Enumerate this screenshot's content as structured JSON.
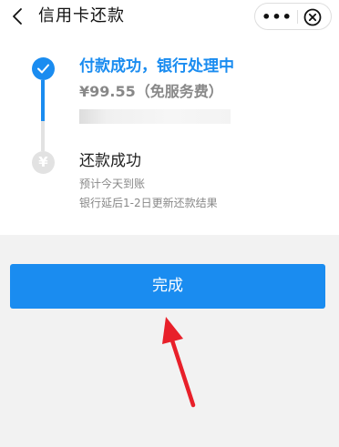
{
  "header": {
    "title": "信用卡还款",
    "back_icon": "chevron-left-icon",
    "more_label": "•••",
    "close_icon": "circle-close-icon"
  },
  "steps": [
    {
      "status": "done",
      "icon": "check-icon",
      "title": "付款成功，银行处理中",
      "amount": "¥99.55（免服务费）"
    },
    {
      "status": "pending",
      "icon": "yuan-icon",
      "icon_glyph": "¥",
      "title": "还款成功",
      "notes": [
        "预计今天到账",
        "银行延后1-2日更新还款结果"
      ]
    }
  ],
  "done_button": {
    "label": "完成"
  },
  "colors": {
    "accent": "#1a8cf0",
    "pending": "#e2e2e2",
    "page_bg": "#f2f2f2",
    "annotation_arrow": "#e8202a"
  }
}
